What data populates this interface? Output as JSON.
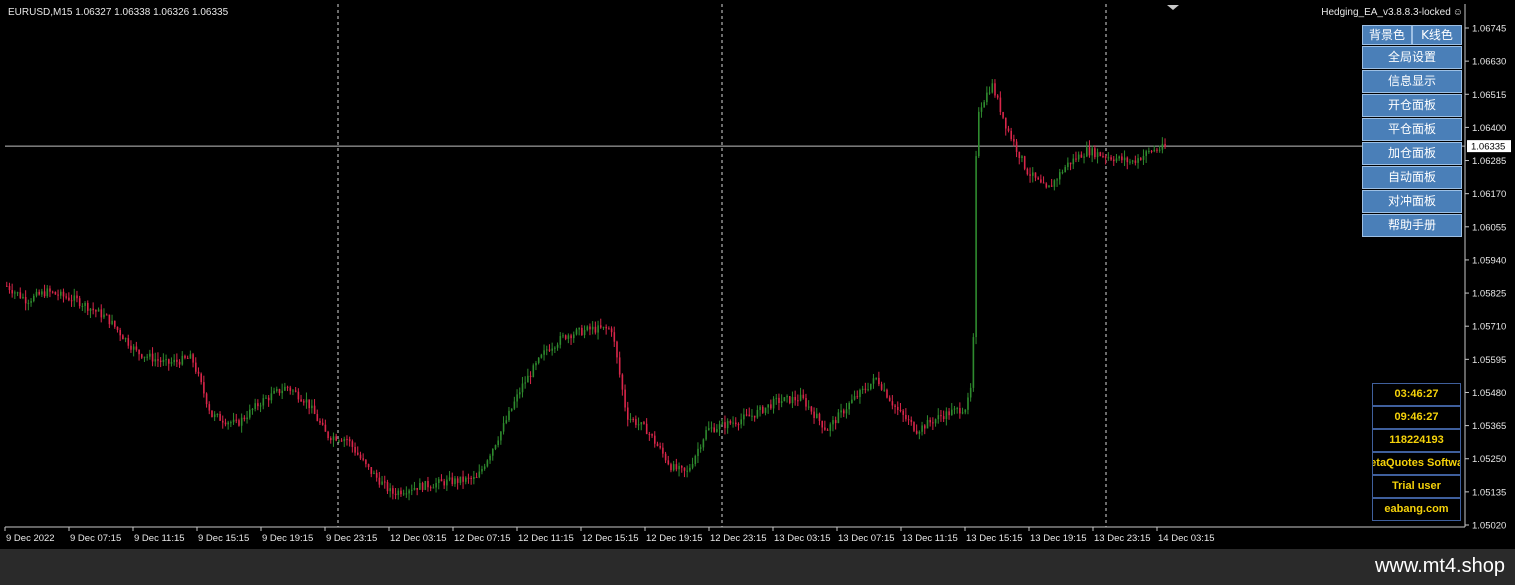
{
  "header": {
    "symbol_info": "EURUSD,M15  1.06327 1.06338 1.06326 1.06335",
    "ea_label": "Hedging_EA_v3.8.8.3-locked",
    "ea_icon": "smiley-icon"
  },
  "current_price_label": "1.06335",
  "panel": {
    "top_buttons": [
      "背景色",
      "K线色"
    ],
    "menu": [
      "全局设置",
      "信息显示",
      "开仓面板",
      "平仓面板",
      "加仓面板",
      "自动面板",
      "对冲面板",
      "帮助手册"
    ],
    "accent_color": "#4a7fb8"
  },
  "info_box": [
    "03:46:27",
    "09:46:27",
    "118224193",
    "MetaQuotes Software Corp.",
    "Trial user",
    "eabang.com"
  ],
  "footer": {
    "site": "www.mt4.shop"
  },
  "chart_data": {
    "type": "candlestick",
    "symbol": "EURUSD",
    "timeframe": "M15",
    "price_axis_ticks": [
      1.06745,
      1.0663,
      1.06515,
      1.064,
      1.06285,
      1.0617,
      1.06055,
      1.0594,
      1.05825,
      1.0571,
      1.05595,
      1.0548,
      1.05365,
      1.0525,
      1.05135,
      1.0502
    ],
    "time_axis_labels": [
      "9 Dec 2022",
      "9 Dec 07:15",
      "9 Dec 11:15",
      "9 Dec 15:15",
      "9 Dec 19:15",
      "9 Dec 23:15",
      "12 Dec 03:15",
      "12 Dec 07:15",
      "12 Dec 11:15",
      "12 Dec 15:15",
      "12 Dec 19:15",
      "12 Dec 23:15",
      "13 Dec 03:15",
      "13 Dec 07:15",
      "13 Dec 11:15",
      "13 Dec 15:15",
      "13 Dec 19:15",
      "13 Dec 23:15",
      "14 Dec 03:15"
    ],
    "period_separators": [
      "9 Dec 23:15",
      "12 Dec 23:15",
      "13 Dec 23:15"
    ],
    "current_price": 1.06335,
    "ylim": [
      1.0502,
      1.06745
    ],
    "bull_color": "#2e8b2e",
    "bear_color": "#d9264a",
    "grid": false,
    "path_points": [
      [
        0,
        1.0585
      ],
      [
        20,
        1.058
      ],
      [
        40,
        1.0583
      ],
      [
        70,
        1.058
      ],
      [
        100,
        1.0574
      ],
      [
        130,
        1.0562
      ],
      [
        160,
        1.0558
      ],
      [
        185,
        1.056
      ],
      [
        205,
        1.054
      ],
      [
        230,
        1.0537
      ],
      [
        255,
        1.0545
      ],
      [
        280,
        1.055
      ],
      [
        300,
        1.0545
      ],
      [
        320,
        1.0533
      ],
      [
        340,
        1.0532
      ],
      [
        360,
        1.0522
      ],
      [
        385,
        1.0513
      ],
      [
        405,
        1.0515
      ],
      [
        440,
        1.0517
      ],
      [
        470,
        1.0518
      ],
      [
        495,
        1.0535
      ],
      [
        515,
        1.055
      ],
      [
        540,
        1.0563
      ],
      [
        560,
        1.0568
      ],
      [
        585,
        1.057
      ],
      [
        605,
        1.057
      ],
      [
        620,
        1.054
      ],
      [
        640,
        1.0535
      ],
      [
        665,
        1.0522
      ],
      [
        680,
        1.052
      ],
      [
        700,
        1.0535
      ],
      [
        720,
        1.0537
      ],
      [
        745,
        1.054
      ],
      [
        770,
        1.0545
      ],
      [
        795,
        1.0546
      ],
      [
        820,
        1.0535
      ],
      [
        845,
        1.0545
      ],
      [
        870,
        1.0553
      ],
      [
        890,
        1.0542
      ],
      [
        910,
        1.0535
      ],
      [
        935,
        1.054
      ],
      [
        960,
        1.0543
      ],
      [
        966,
        1.0552
      ],
      [
        970,
        1.0645
      ],
      [
        985,
        1.0655
      ],
      [
        1000,
        1.064
      ],
      [
        1020,
        1.0625
      ],
      [
        1040,
        1.0618
      ],
      [
        1060,
        1.0627
      ],
      [
        1080,
        1.0632
      ],
      [
        1100,
        1.063
      ],
      [
        1125,
        1.0628
      ],
      [
        1145,
        1.0632
      ],
      [
        1165,
        1.06335
      ]
    ]
  }
}
